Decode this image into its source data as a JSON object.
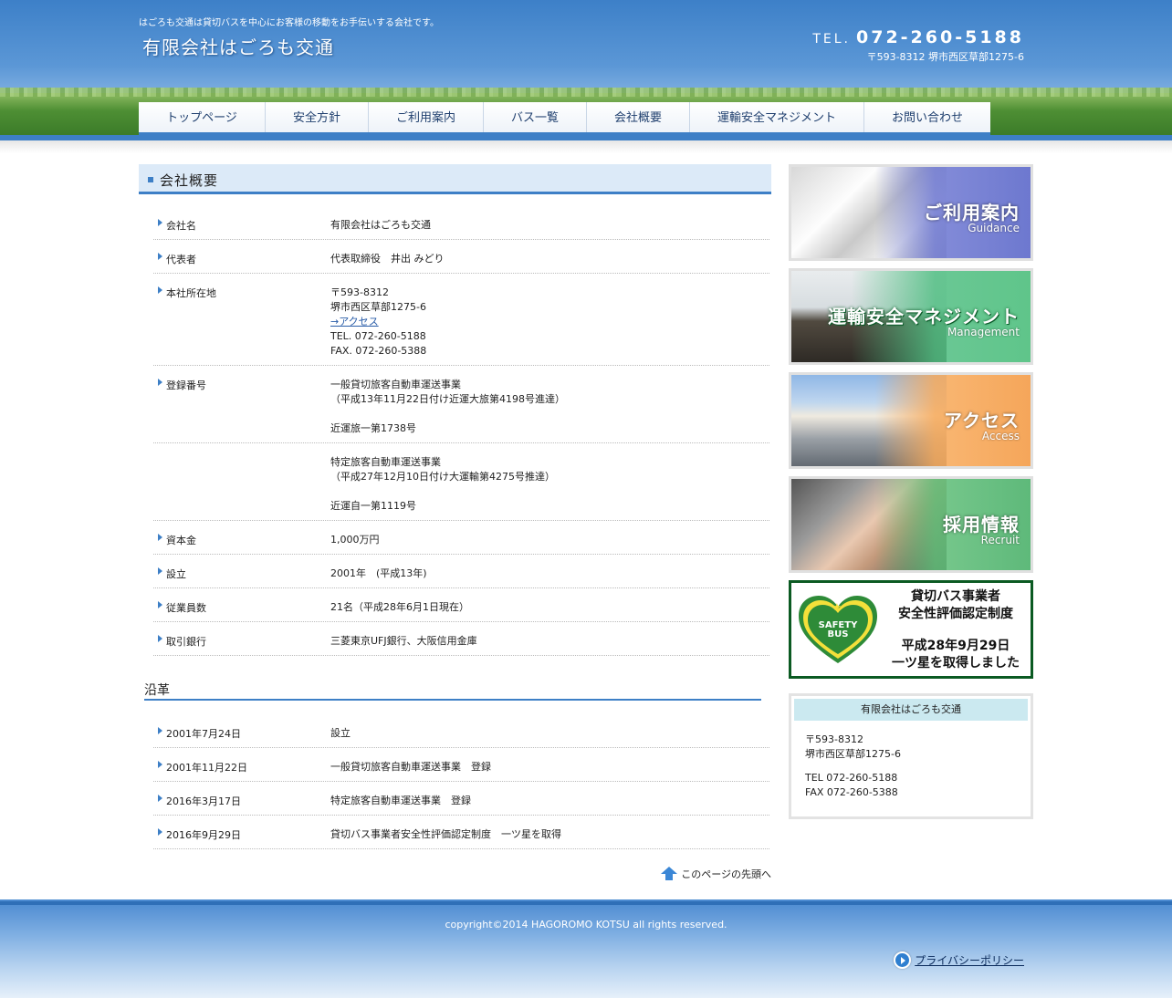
{
  "header": {
    "tagline": "はごろも交通は貸切バスを中心にお客様の移動をお手伝いする会社です。",
    "logo": "有限会社はごろも交通",
    "tel_label": "TEL.",
    "tel_number": "072-260-5188",
    "address": "〒593-8312 堺市西区草部1275-6"
  },
  "nav": [
    {
      "label": "トップページ"
    },
    {
      "label": "安全方針"
    },
    {
      "label": "ご利用案内"
    },
    {
      "label": "バス一覧"
    },
    {
      "label": "会社概要"
    },
    {
      "label": "運輸安全マネジメント"
    },
    {
      "label": "お問い合わせ"
    }
  ],
  "main": {
    "title": "会社概要",
    "profile": [
      {
        "label": "会社名",
        "value": [
          "有限会社はごろも交通"
        ]
      },
      {
        "label": "代表者",
        "value": [
          "代表取締役　井出 みどり"
        ]
      },
      {
        "label": "本社所在地",
        "value": [
          "〒593-8312",
          "堺市西区草部1275-6",
          "→アクセス",
          "TEL. 072-260-5188",
          "FAX. 072-260-5388"
        ]
      },
      {
        "label": "登録番号",
        "value": [
          "一般貸切旅客自動車運送事業",
          "（平成13年11月22日付け近運大旅第4198号進達）",
          "",
          "近運旅一第1738号"
        ]
      },
      {
        "label": "",
        "value": [
          "特定旅客自動車運送事業",
          "（平成27年12月10日付け大運輸第4275号推達）",
          "",
          "近運自一第1119号"
        ]
      },
      {
        "label": "資本金",
        "value": [
          "1,000万円"
        ]
      },
      {
        "label": "設立",
        "value": [
          "2001年　(平成13年)"
        ]
      },
      {
        "label": "従業員数",
        "value": [
          "21名（平成28年6月1日現在）"
        ]
      },
      {
        "label": "取引銀行",
        "value": [
          "三菱東京UFJ銀行、大阪信用金庫"
        ]
      }
    ],
    "history_title": "沿革",
    "history": [
      {
        "label": "2001年7月24日",
        "value": [
          "設立"
        ]
      },
      {
        "label": "2001年11月22日",
        "value": [
          "一般貸切旅客自動車運送事業　登録"
        ]
      },
      {
        "label": "2016年3月17日",
        "value": [
          "特定旅客自動車運送事業　登録"
        ]
      },
      {
        "label": "2016年9月29日",
        "value": [
          "貸切バス事業者安全性評価認定制度　一ツ星を取得"
        ]
      }
    ],
    "page_top": "このページの先頭へ"
  },
  "sidebar": {
    "banners": [
      {
        "title": "ご利用案内",
        "sub": "Guidance"
      },
      {
        "title": "運輸安全マネジメント",
        "sub": "Management"
      },
      {
        "title": "アクセス",
        "sub": "Access"
      },
      {
        "title": "採用情報",
        "sub": "Recruit"
      }
    ],
    "safety": {
      "badge_line1": "SAFETY",
      "badge_line2": "BUS",
      "title_line1": "貸切バス事業者",
      "title_line2": "安全性評価認定制度",
      "date": "平成28年9月29日",
      "result": "一ツ星を取得しました"
    },
    "company": {
      "name": "有限会社はごろも交通",
      "postal": "〒593-8312",
      "address": "堺市西区草部1275-6",
      "tel": "TEL 072-260-5188",
      "fax": "FAX 072-260-5388"
    }
  },
  "footer": {
    "copyright": "copyright©2014 HAGOROMO KOTSU all rights reserved.",
    "privacy": "プライバシーポリシー"
  }
}
